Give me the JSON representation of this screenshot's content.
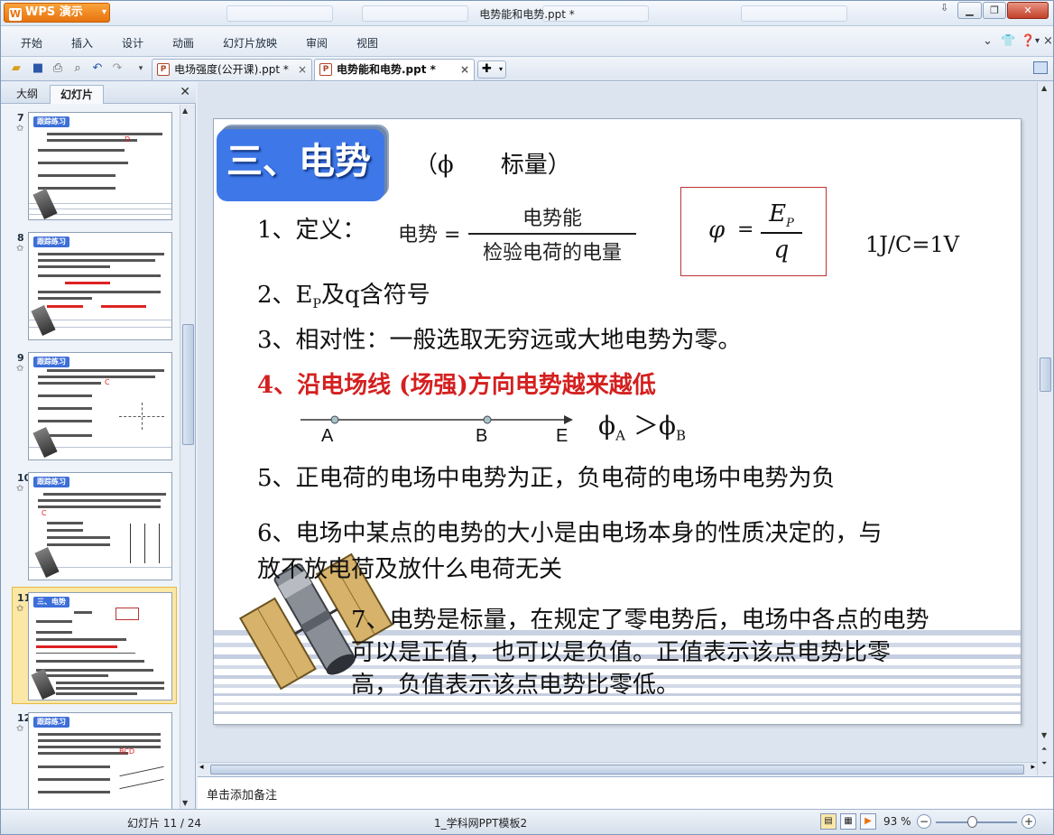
{
  "window": {
    "app_button": "WPS 演示",
    "title": "电势能和电势.ppt *"
  },
  "menu": {
    "items": [
      "开始",
      "插入",
      "设计",
      "动画",
      "幻灯片放映",
      "审阅",
      "视图"
    ]
  },
  "tabs": [
    {
      "label": "电场强度(公开课).ppt *"
    },
    {
      "label": "电势能和电势.ppt *"
    }
  ],
  "left_panel": {
    "tab_outline": "大纲",
    "tab_slides": "幻灯片",
    "thumbnails": [
      {
        "number": "7",
        "badge": "跟踪练习",
        "answer": "D"
      },
      {
        "number": "8",
        "badge": "跟踪练习",
        "answer": ""
      },
      {
        "number": "9",
        "badge": "跟踪练习",
        "answer": "C"
      },
      {
        "number": "10",
        "badge": "跟踪练习",
        "answer": "C"
      },
      {
        "number": "11",
        "badge": "三、电势",
        "answer": ""
      },
      {
        "number": "12",
        "badge": "跟踪练习",
        "answer": "BCD"
      }
    ],
    "selected_index": 4
  },
  "slide": {
    "title": "三、电势",
    "title_sub": "（ϕ　　标量）",
    "item1_label": "1、定义：",
    "formula_label": "电势 =",
    "formula_numerator": "电势能",
    "formula_denominator": "检验电荷的电量",
    "phi_lhs": "φ",
    "phi_eq": "=",
    "phi_num_main": "E",
    "phi_num_sub": "P",
    "phi_den": "q",
    "unit": "1J/C=1V",
    "item2_pre": "2、E",
    "item2_sub": "P",
    "item2_post": "及q含符号",
    "item3": "3、相对性：一般选取无穷远或大地电势为零。",
    "item4": "4、沿电场线 (场强)方向电势越来越低",
    "point_a": "A",
    "point_b": "B",
    "point_e": "E",
    "phi_a": "ϕ",
    "phi_a_sub": "A",
    "gt": " ＞ϕ",
    "phi_b_sub": "B",
    "item5": "5、正电荷的电场中电势为正，负电荷的电场中电势为负",
    "item6_line1": "6、电场中某点的电势的大小是由电场本身的性质决定的，与",
    "item6_line2": "放不放电荷及放什么电荷无关",
    "item7_line1": "7、电势是标量，在规定了零电势后，电场中各点的电势",
    "item7_line2": "可以是正值，也可以是负值。正值表示该点电势比零",
    "item7_line3": "高，负值表示该点电势比零低。"
  },
  "notes": {
    "placeholder": "单击添加备注"
  },
  "status": {
    "slide_info": "幻灯片 11 / 24",
    "template": "1_学科网PPT模板2",
    "zoom": "93 %"
  },
  "colors": {
    "title_blue": "#3e78e8",
    "highlight_red": "#d42020",
    "wps_orange": "#e8740f"
  }
}
